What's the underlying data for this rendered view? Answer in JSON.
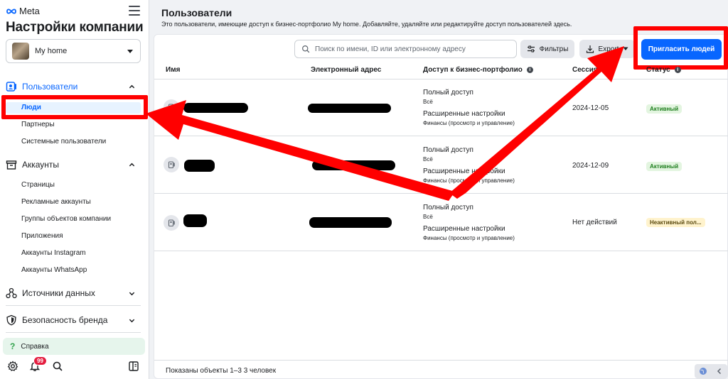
{
  "sidebar": {
    "brand": "Meta",
    "title": "Настройки компании",
    "account": "My home",
    "sections": [
      {
        "label": "Пользователи",
        "items": [
          "Люди",
          "Партнеры",
          "Системные пользователи"
        ]
      },
      {
        "label": "Аккаунты",
        "items": [
          "Страницы",
          "Рекламные аккаунты",
          "Группы объектов компании",
          "Приложения",
          "Аккаунты Instagram",
          "Аккаунты WhatsApp"
        ]
      },
      {
        "label": "Источники данных"
      },
      {
        "label": "Безопасность бренда"
      }
    ],
    "help": "Справка",
    "notifications_count": "99"
  },
  "main": {
    "title": "Пользователи",
    "subtitle": "Это пользователи, имеющие доступ к бизнес-портфолио My home. Добавляйте, удаляйте или редактируйте доступ пользователей здесь.",
    "search_placeholder": "Поиск по имени, ID или электронному адресу",
    "filters_label": "Фильтры",
    "export_label": "Export",
    "invite_label": "Пригласить людей",
    "columns": [
      "Имя",
      "Электронный адрес",
      "Доступ к бизнес-портфолио",
      "Сессия",
      "Статус"
    ],
    "rows": [
      {
        "access_title": "Полный доступ",
        "access_sub": "Всё",
        "adv_title": "Расширенные настройки",
        "adv_sub": "Финансы (просмотр и управление)",
        "session": "2024-12-05",
        "status": "Активный"
      },
      {
        "access_title": "Полный доступ",
        "access_sub": "Всё",
        "adv_title": "Расширенные настройки",
        "adv_sub": "Финансы (просмотр и управление)",
        "session": "2024-12-09",
        "status": "Активный"
      },
      {
        "access_title": "Полный доступ",
        "access_sub": "Всё",
        "adv_title": "Расширенные настройки",
        "adv_sub": "Финансы (просмотр и управление)",
        "session": "Нет действий",
        "status": "Неактивный пол..."
      }
    ],
    "footer": "Показаны объекты 1–3 3 человек"
  },
  "colors": {
    "accent": "#0866ff",
    "annotation": "#ff0000",
    "active_status": "#1e7e1e",
    "inactive_status_bg": "#fff3cd"
  }
}
